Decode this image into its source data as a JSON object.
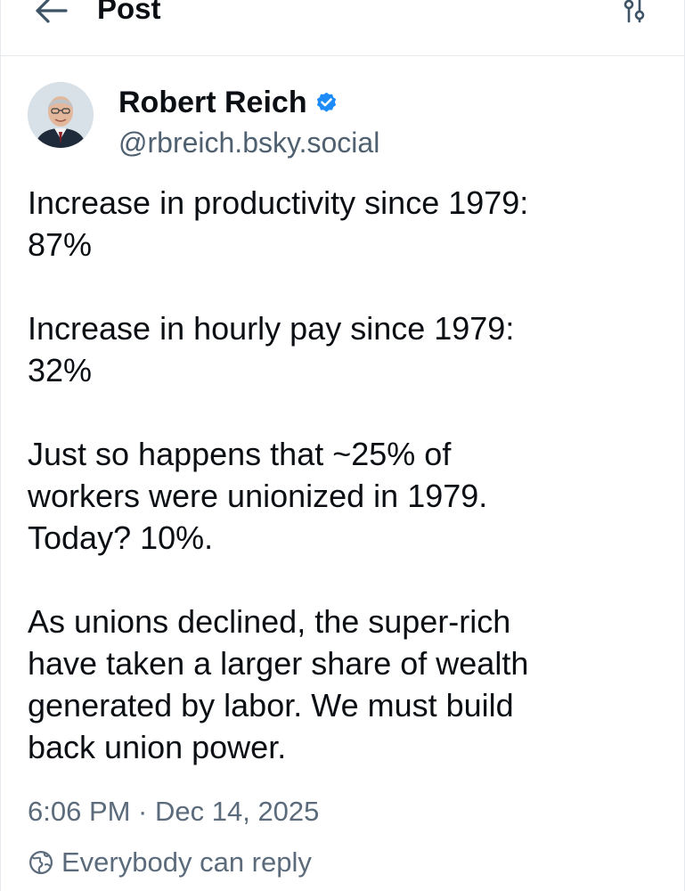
{
  "header": {
    "title": "Post",
    "back_icon": "arrow-left-icon",
    "settings_icon": "sliders-icon"
  },
  "author": {
    "display_name": "Robert Reich",
    "handle": "@rbreich.bsky.social",
    "verified_icon": "verified-check-icon",
    "verified_color": "#1d8cf8"
  },
  "post": {
    "paragraphs": [
      [
        "Increase in productivity since 1979:",
        "87%"
      ],
      [
        "Increase in hourly pay since 1979:",
        "32%"
      ],
      [
        "Just so happens that ~25% of",
        "workers were unionized in 1979.",
        "Today? 10%."
      ],
      [
        "As unions declined, the super-rich",
        "have taken a larger share of wealth",
        "generated by labor. We must build",
        "back union power."
      ]
    ]
  },
  "meta": {
    "timestamp": "6:06 PM · Dec 14, 2025",
    "reply_setting": "Everybody can reply",
    "reply_icon": "globe-icon"
  },
  "colors": {
    "text_primary": "#0b0f14",
    "text_secondary": "#5b6b7b",
    "border": "#e6e9ee"
  }
}
